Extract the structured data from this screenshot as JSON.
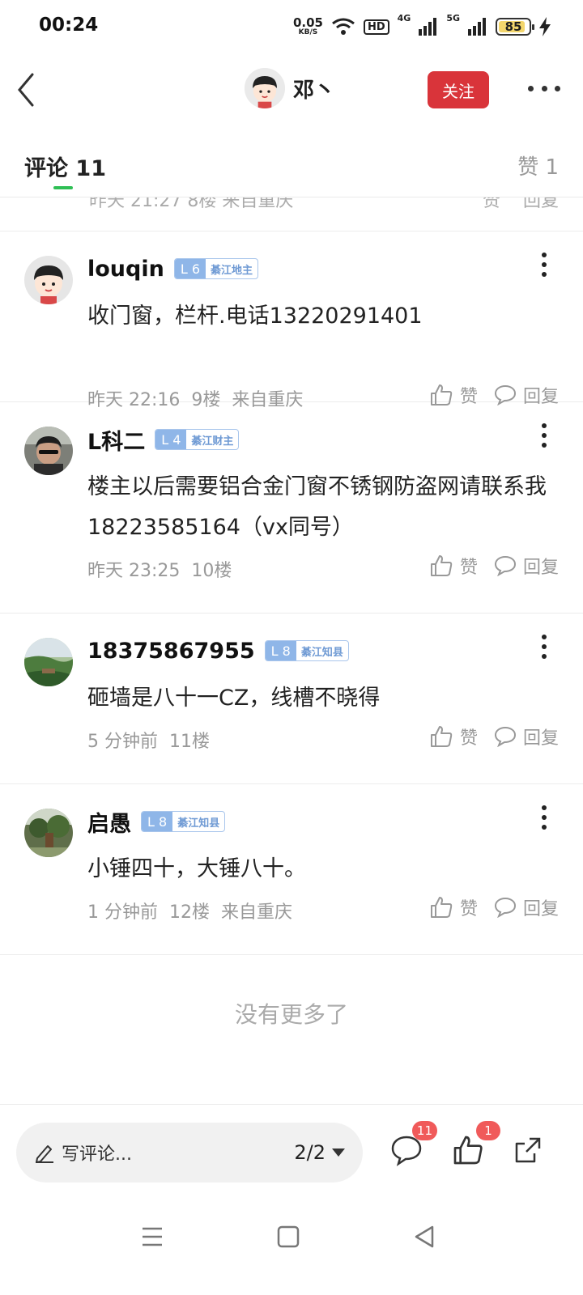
{
  "status_bar": {
    "time": "00:24",
    "net_speed_value": "0.05",
    "net_speed_unit": "KB/S",
    "hd_label": "HD",
    "network_1": "4G",
    "network_2": "5G",
    "battery": "85"
  },
  "header": {
    "author_name": "邓丶",
    "follow_label": "关注"
  },
  "tabs": {
    "comments_label": "评论",
    "comments_count": "11",
    "likes_label": "赞 1"
  },
  "peek_comment": {
    "meta": "昨天 21:27  8楼  来自重庆",
    "like_label": "赞",
    "reply_label": "回复"
  },
  "comments": [
    {
      "name": "louqin",
      "level": "L 6",
      "level_title": "綦江地主",
      "text": "收门窗，栏杆.电话13220291401",
      "time": "昨天 22:16",
      "floor": "9楼",
      "location": "来自重庆",
      "like_label": "赞",
      "reply_label": "回复"
    },
    {
      "name": "L科二",
      "level": "L 4",
      "level_title": "綦江财主",
      "text": "楼主以后需要铝合金门窗不锈钢防盗网请联系我18223585164（vx同号）",
      "time": "昨天 23:25",
      "floor": "10楼",
      "location": "",
      "like_label": "赞",
      "reply_label": "回复"
    },
    {
      "name": "18375867955",
      "level": "L 8",
      "level_title": "綦江知县",
      "text": "砸墙是八十一CZ，线槽不晓得",
      "time": "5 分钟前",
      "floor": "11楼",
      "location": "",
      "like_label": "赞",
      "reply_label": "回复"
    },
    {
      "name": "启愚",
      "level": "L 8",
      "level_title": "綦江知县",
      "text": "小锤四十，大锤八十。",
      "time": "1 分钟前",
      "floor": "12楼",
      "location": "来自重庆",
      "like_label": "赞",
      "reply_label": "回复"
    }
  ],
  "no_more_text": "没有更多了",
  "bottom_bar": {
    "comment_placeholder": "写评论...",
    "page_indicator": "2/2",
    "comment_badge": "11",
    "like_badge": "1"
  },
  "colors": {
    "follow_button": "#d9343a",
    "tab_indicator": "#2fbf55",
    "badge": "#f05a5a",
    "level_badge": "#8fb6e8"
  }
}
